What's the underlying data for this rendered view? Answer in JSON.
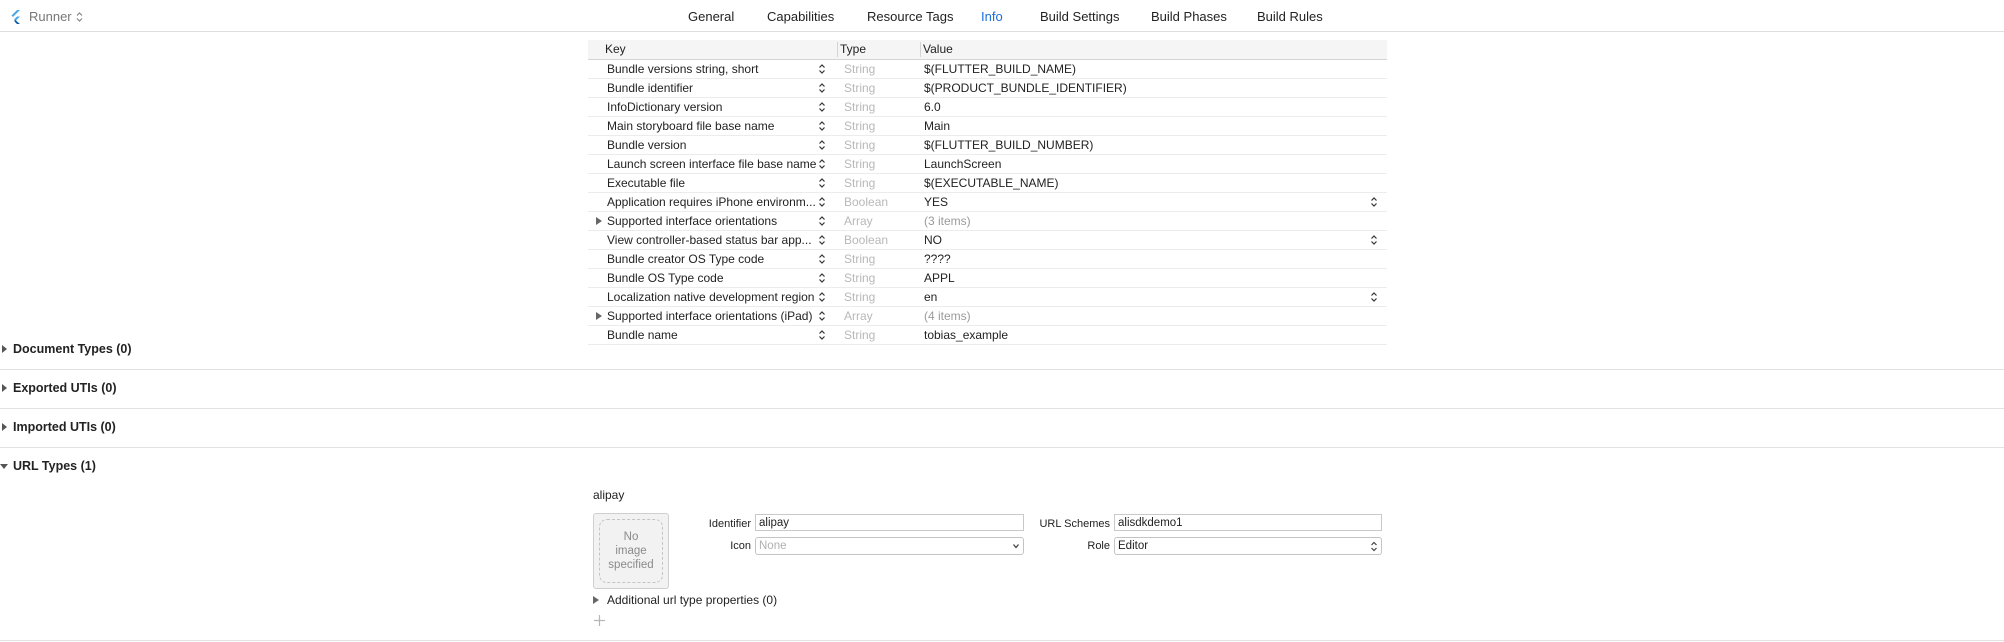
{
  "toolbar": {
    "target": "Runner",
    "tabs": [
      "General",
      "Capabilities",
      "Resource Tags",
      "Info",
      "Build Settings",
      "Build Phases",
      "Build Rules"
    ],
    "active_tab": "Info",
    "accent": "#1c6fe0"
  },
  "plist": {
    "headers": {
      "key": "Key",
      "type": "Type",
      "value": "Value"
    },
    "rows": [
      {
        "key": "Bundle versions string, short",
        "type": "String",
        "value": "$(FLUTTER_BUILD_NAME)"
      },
      {
        "key": "Bundle identifier",
        "type": "String",
        "value": "$(PRODUCT_BUNDLE_IDENTIFIER)"
      },
      {
        "key": "InfoDictionary version",
        "type": "String",
        "value": "6.0"
      },
      {
        "key": "Main storyboard file base name",
        "type": "String",
        "value": "Main"
      },
      {
        "key": "Bundle version",
        "type": "String",
        "value": "$(FLUTTER_BUILD_NUMBER)"
      },
      {
        "key": "Launch screen interface file base name",
        "type": "String",
        "value": "LaunchScreen"
      },
      {
        "key": "Executable file",
        "type": "String",
        "value": "$(EXECUTABLE_NAME)"
      },
      {
        "key": "Application requires iPhone environm...",
        "type": "Boolean",
        "value": "YES",
        "value_stepper": true
      },
      {
        "key": "Supported interface orientations",
        "type": "Array",
        "value": "(3 items)",
        "expandable": true,
        "muted": true
      },
      {
        "key": "View controller-based status bar app...",
        "type": "Boolean",
        "value": "NO",
        "value_stepper": true
      },
      {
        "key": "Bundle creator OS Type code",
        "type": "String",
        "value": "????"
      },
      {
        "key": "Bundle OS Type code",
        "type": "String",
        "value": "APPL"
      },
      {
        "key": "Localization native development region",
        "type": "String",
        "value": "en",
        "value_stepper": true
      },
      {
        "key": "Supported interface orientations (iPad)",
        "type": "Array",
        "value": "(4 items)",
        "expandable": true,
        "muted": true
      },
      {
        "key": "Bundle name",
        "type": "String",
        "value": "tobias_example"
      }
    ]
  },
  "sections": {
    "document_types": "Document Types (0)",
    "exported_utis": "Exported UTIs (0)",
    "imported_utis": "Imported UTIs (0)",
    "url_types": "URL Types (1)"
  },
  "url_type": {
    "name": "alipay",
    "no_image": "No\nimage\nspecified",
    "identifier_label": "Identifier",
    "identifier_value": "alipay",
    "icon_label": "Icon",
    "icon_placeholder": "None",
    "url_schemes_label": "URL Schemes",
    "url_schemes_value": "alisdkdemo1",
    "role_label": "Role",
    "role_value": "Editor",
    "additional_props": "Additional url type properties (0)"
  }
}
